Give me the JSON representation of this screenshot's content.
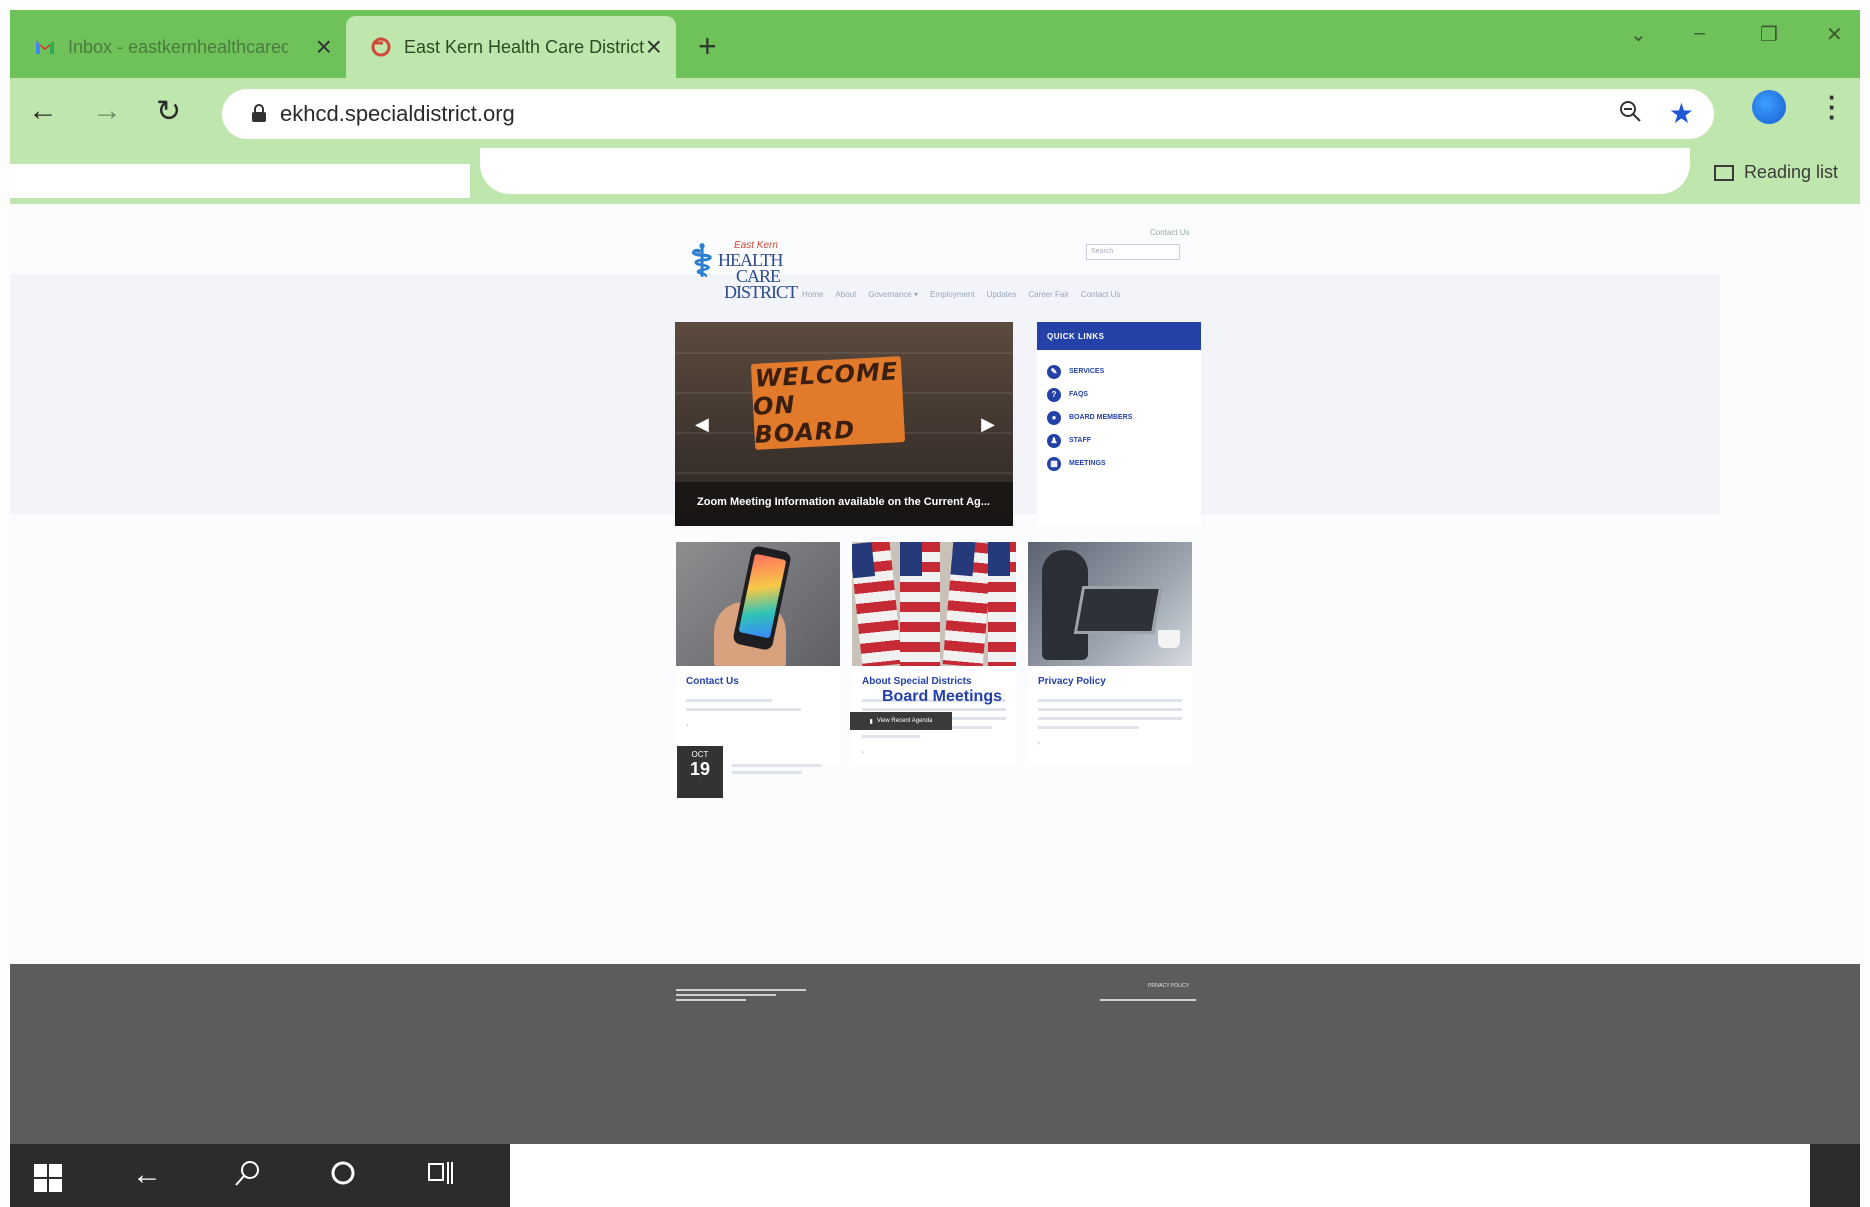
{
  "browser": {
    "tabs": [
      {
        "title": "Inbox - eastkernhealthcaredis",
        "favicon": "gmail-icon",
        "active": false
      },
      {
        "title": "East Kern Health Care District",
        "favicon": "site-favicon-icon",
        "active": true
      }
    ],
    "new_tab_label": "+",
    "url": "ekhcd.specialdistrict.org",
    "reading_list_label": "Reading list",
    "accent_color": "#6fc25a",
    "toolbar_color": "#bfe7ad"
  },
  "site": {
    "logo": {
      "line1": "East Kern",
      "line2": "HEALTH",
      "line3": "CARE",
      "line4": "DISTRICT"
    },
    "contact_link": "Contact Us",
    "search_placeholder": "Search",
    "nav": [
      "Home",
      "About",
      "Governance ▾",
      "Employment",
      "Updates",
      "Career Fair",
      "Contact Us"
    ],
    "slider": {
      "sign_line1": "WELCOME",
      "sign_line2": "ON BOARD",
      "caption": "Zoom Meeting Information available on the Current Ag..."
    },
    "quick_links": {
      "heading": "QUICK LINKS",
      "items": [
        {
          "label": "SERVICES",
          "icon": "wrench-icon"
        },
        {
          "label": "FAQS",
          "icon": "question-icon"
        },
        {
          "label": "BOARD MEMBERS",
          "icon": "people-icon"
        },
        {
          "label": "STAFF",
          "icon": "person-icon"
        },
        {
          "label": "MEETINGS",
          "icon": "calendar-icon"
        }
      ]
    },
    "cards": [
      {
        "title": "Contact Us",
        "image": "phone-image"
      },
      {
        "title": "About Special Districts",
        "image": "flags-image"
      },
      {
        "title": "Privacy Policy",
        "image": "laptop-image"
      }
    ],
    "board_meetings": {
      "title": "Board Meetings",
      "button_label": "View Recent Agenda",
      "event": {
        "month": "OCT",
        "day": "19"
      }
    },
    "footer": {
      "privacy": "PRIVACY POLICY"
    }
  }
}
